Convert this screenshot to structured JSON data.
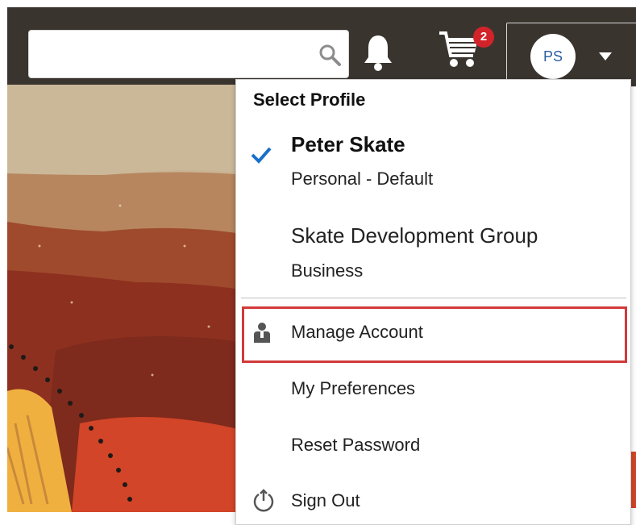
{
  "header": {
    "search": {
      "value": "",
      "placeholder": ""
    },
    "cart_count": "2",
    "avatar_initials": "PS"
  },
  "menu": {
    "heading": "Select Profile",
    "profiles": [
      {
        "name": "Peter Skate",
        "type": "Personal - Default",
        "selected": true
      },
      {
        "name": "Skate Development Group",
        "type": "Business",
        "selected": false
      }
    ],
    "items": [
      {
        "label": "Manage Account",
        "icon": "person-icon"
      },
      {
        "label": "My Preferences",
        "icon": ""
      },
      {
        "label": "Reset Password",
        "icon": ""
      },
      {
        "label": "Sign Out",
        "icon": "power-icon"
      }
    ]
  },
  "colors": {
    "header_bg": "#3a342f",
    "badge": "#d2232a",
    "check": "#1a6fc9",
    "highlight_border": "#d23a3a"
  }
}
